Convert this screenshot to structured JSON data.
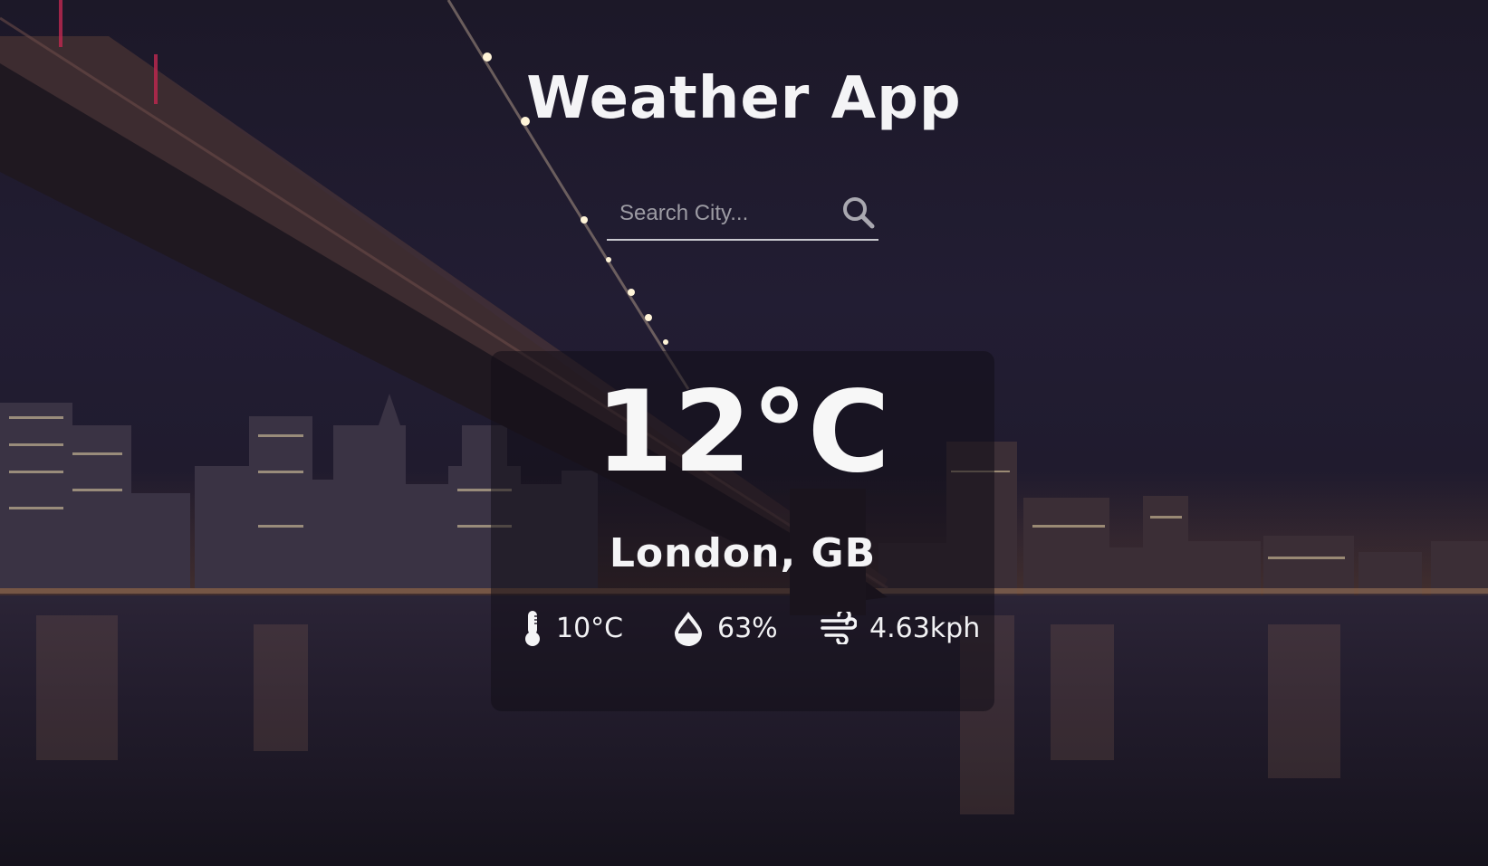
{
  "app": {
    "title": "Weather App"
  },
  "search": {
    "placeholder": "Search City...",
    "icon": "magnifier"
  },
  "weather": {
    "temperature": "12°C",
    "location": "London,  GB",
    "feels_like": "10°C",
    "humidity": "63%",
    "wind_speed": "4.63kph"
  },
  "icons": {
    "feels_like": "thermometer",
    "humidity": "water-drop",
    "wind": "wind"
  },
  "colors": {
    "text": "#f4f4f6",
    "card_background": "rgba(18,15,24,0.55)",
    "search_underline": "#c9c9cf"
  }
}
